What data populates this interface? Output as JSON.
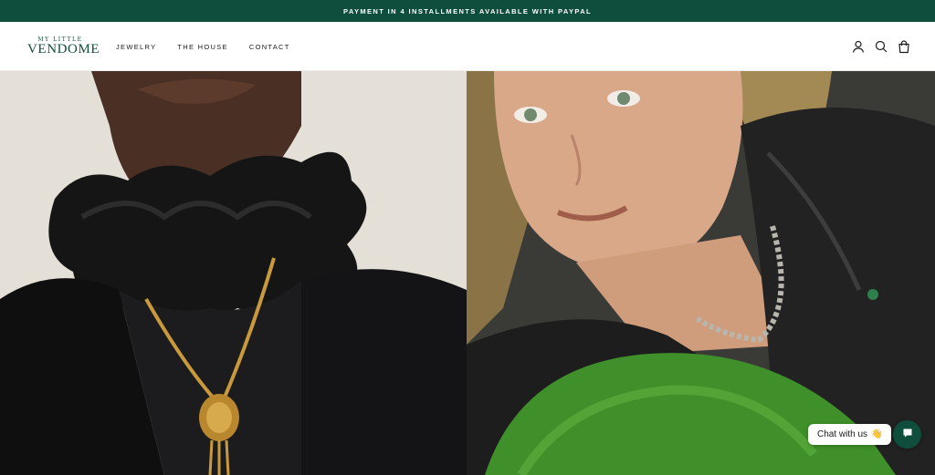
{
  "announcement": {
    "text": "PAYMENT IN 4 INSTALLMENTS AVAILABLE WITH PAYPAL"
  },
  "header": {
    "logo": {
      "top": "MY LITTLE",
      "main": "VENDOME"
    },
    "nav": [
      {
        "label": "JEWELRY"
      },
      {
        "label": "THE HOUSE"
      },
      {
        "label": "CONTACT"
      }
    ],
    "icons": [
      "account-icon",
      "search-icon",
      "cart-icon"
    ]
  },
  "hero": {
    "left": {
      "description_icon": "model-photo"
    },
    "right": {
      "description_icon": "model-photo"
    }
  },
  "chat": {
    "label": "Chat with us",
    "emoji": "👋",
    "icon": "chat-icon"
  },
  "colors": {
    "brand": "#0f4d3c",
    "background": "#ffffff"
  }
}
